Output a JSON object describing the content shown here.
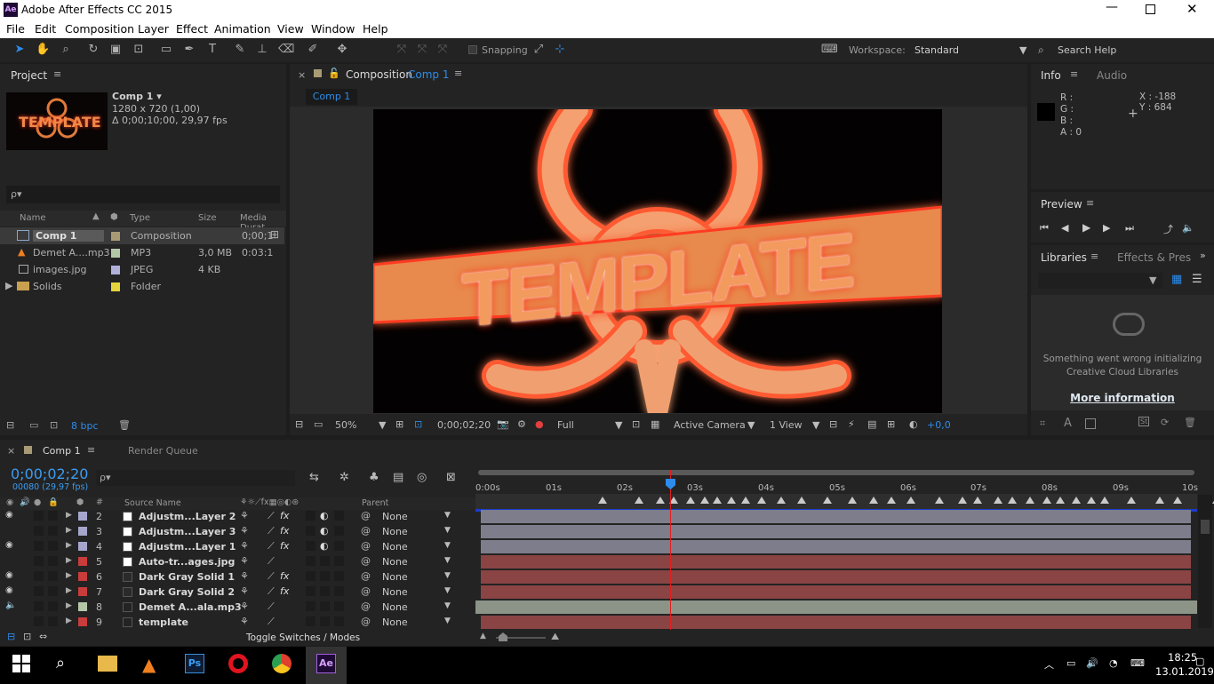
{
  "app": {
    "title": "Adobe After Effects CC 2015",
    "icon": "Ae",
    "window_controls": [
      "minimize-icon",
      "restore-icon",
      "close-icon"
    ]
  },
  "menu": [
    "File",
    "Edit",
    "Composition",
    "Layer",
    "Effect",
    "Animation",
    "View",
    "Window",
    "Help"
  ],
  "toolbar": {
    "snapping": "Snapping",
    "workspace_label": "Workspace:",
    "workspace_value": "Standard",
    "search_placeholder": "Search Help"
  },
  "project": {
    "title": "Project",
    "comp_name": "Comp 1 ▾",
    "comp_res": "1280 x 720 (1,00)",
    "comp_dur": "Δ 0;00;10;00, 29,97 fps",
    "thumb_text": "TEMPLATE",
    "search_placeholder": "ρ▾",
    "columns": [
      "Name",
      "Type",
      "Size",
      "Media Durat"
    ],
    "items": [
      {
        "name": "Comp 1",
        "type": "Composition",
        "size": "",
        "dur": "0;00;1",
        "color": "#a89a74"
      },
      {
        "name": "Demet A....mp3",
        "type": "MP3",
        "size": "3,0 MB",
        "dur": "0:03:1",
        "color": "#b4c8a8"
      },
      {
        "name": "images.jpg",
        "type": "JPEG",
        "size": "4 KB",
        "dur": "",
        "color": "#b0b0d8"
      },
      {
        "name": "Solids",
        "type": "Folder",
        "size": "",
        "dur": "",
        "color": "#e6d43c"
      }
    ],
    "bpc": "8 bpc"
  },
  "comp_panel": {
    "title": "Composition",
    "comp": "Comp 1",
    "tab": "Comp 1",
    "zoom": "50%",
    "timecode": "0;00;02;20",
    "resolution": "Full",
    "camera": "Active Camera",
    "view": "1 View",
    "exposure": "+0,0",
    "render_text": "TEMPLATE"
  },
  "info": {
    "title": "Info",
    "tab2": "Audio",
    "r": "R :",
    "g": "G :",
    "b": "B :",
    "a": "A : 0",
    "x": "X : -188",
    "y": "Y : 684"
  },
  "preview": {
    "title": "Preview"
  },
  "libraries": {
    "title": "Libraries",
    "tab2": "Effects & Pres",
    "error": "Something went wrong initializing Creative Cloud Libraries",
    "more": "More information"
  },
  "timeline": {
    "tab": "Comp 1",
    "render_queue": "Render Queue",
    "timecode": "0;00;02;20",
    "fps": "00080 (29,97 fps)",
    "search_placeholder": "ρ▾",
    "col_source": "Source Name",
    "col_parent": "Parent",
    "toggle": "Toggle Switches / Modes",
    "ruler": [
      "0:00s",
      "01s",
      "02s",
      "03s",
      "04s",
      "05s",
      "06s",
      "07s",
      "08s",
      "09s",
      "10s"
    ],
    "layers": [
      {
        "num": "2",
        "name": "Adjustm...Layer 2",
        "parent": "None",
        "color": "#a6a6cc",
        "bar": "#7d7d8c",
        "fx": true
      },
      {
        "num": "3",
        "name": "Adjustm...Layer 3",
        "parent": "None",
        "color": "#a6a6cc",
        "bar": "#7d7d8c",
        "fx": true
      },
      {
        "num": "4",
        "name": "Adjustm...Layer 1",
        "parent": "None",
        "color": "#a6a6cc",
        "bar": "#7d7d8c",
        "fx": true
      },
      {
        "num": "5",
        "name": "Auto-tr...ages.jpg",
        "parent": "None",
        "color": "#c83c3c",
        "bar": "#8a4444",
        "fx": false
      },
      {
        "num": "6",
        "name": "Dark Gray Solid 1",
        "parent": "None",
        "color": "#c83c3c",
        "bar": "#8a4444",
        "fx": true
      },
      {
        "num": "7",
        "name": "Dark Gray Solid 2",
        "parent": "None",
        "color": "#c83c3c",
        "bar": "#8a4444",
        "fx": true
      },
      {
        "num": "8",
        "name": "Demet A...ala.mp3",
        "parent": "None",
        "color": "#b4c8a8",
        "bar": "#8c9488",
        "fx": false
      },
      {
        "num": "9",
        "name": "template",
        "parent": "None",
        "color": "#c83c3c",
        "bar": "#8a4444",
        "fx": false
      }
    ]
  },
  "taskbar": {
    "time": "18:25",
    "date": "13.01.2019"
  },
  "colors": {
    "accent": "#2d8ceb",
    "playhead": "#e02020"
  }
}
